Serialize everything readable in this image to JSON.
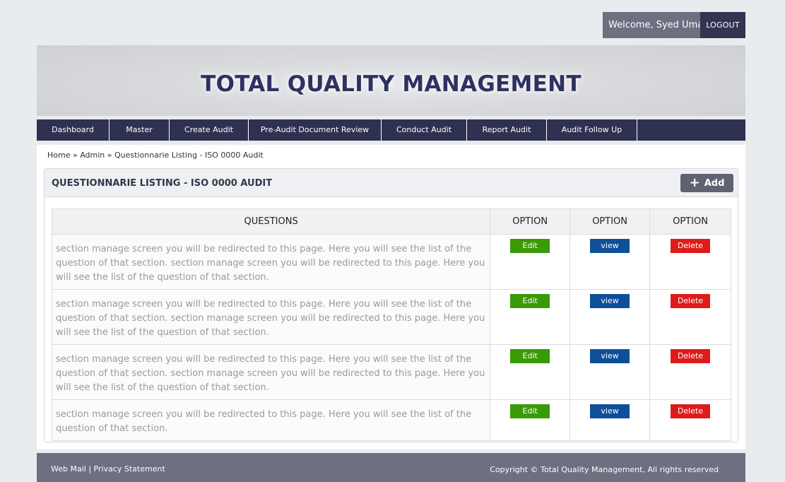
{
  "header": {
    "welcome": "Welcome, Syed Umar",
    "logout": "LOGOUT",
    "title": "TOTAL QUALITY MANAGEMENT"
  },
  "nav": {
    "items": [
      {
        "label": "Dashboard"
      },
      {
        "label": "Master"
      },
      {
        "label": "Create Audit"
      },
      {
        "label": "Pre-Audit Document Review"
      },
      {
        "label": "Conduct Audit"
      },
      {
        "label": "Report Audit"
      },
      {
        "label": "Audit Follow Up"
      }
    ]
  },
  "breadcrumb": {
    "home": "Home",
    "sep1": "»",
    "admin": "Admin",
    "sep2": "»",
    "current": "Questionnarie Listing - ISO 0000 Audit"
  },
  "panel": {
    "title": "QUESTIONNARIE LISTING - ISO 0000 AUDIT",
    "add_label": "Add"
  },
  "table": {
    "headers": [
      "QUESTIONS",
      "OPTION",
      "OPTION",
      "OPTION"
    ],
    "edit_label": "Edit",
    "view_label": "view",
    "delete_label": "Delete",
    "rows": [
      {
        "question": "section manage screen you will be redirected to this page. Here you will see the list of the question of that section. section manage screen you will be redirected to this page. Here you will see the list of the question of that section."
      },
      {
        "question": "section manage screen you will be redirected to this page. Here you will see the list of the question of that section. section manage screen you will be redirected to this page. Here you will see the list of the question of that section."
      },
      {
        "question": "section manage screen you will be redirected to this page. Here you will see the list of the question of that section. section manage screen you will be redirected to this page. Here you will see the list of the question of that section."
      },
      {
        "question": "section manage screen you will be redirected to this page. Here you will see the list of the question of that section."
      }
    ]
  },
  "footer": {
    "webmail": "Web Mail",
    "divider": "|",
    "privacy": "Privacy Statement",
    "copyright": "Copyright © Total Quality Management, All rights reserved"
  },
  "colors": {
    "nav_bg": "#2f3150",
    "edit": "#3a9a06",
    "view": "#0f4f9a",
    "delete": "#dd1b1b",
    "title": "#2e3260"
  },
  "icons": {
    "add": "plus-icon"
  }
}
